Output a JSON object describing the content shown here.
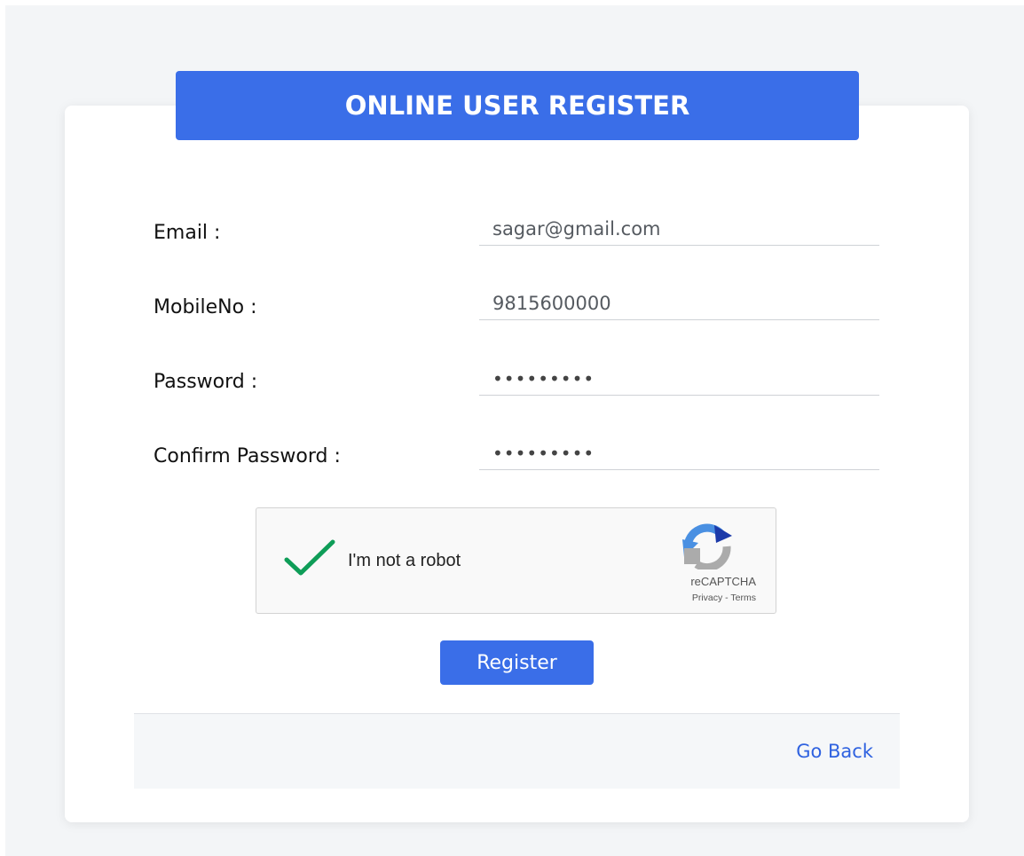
{
  "header": {
    "title": "ONLINE USER REGISTER"
  },
  "form": {
    "email_label": "Email :",
    "email_value": "sagar@gmail.com",
    "mobile_label": "MobileNo :",
    "mobile_value": "9815600000",
    "password_label": "Password :",
    "password_value": "•••••••••",
    "confirm_label": "Confirm Password :",
    "confirm_value": "•••••••••"
  },
  "recaptcha": {
    "checked": true,
    "label": "I'm not a robot",
    "brand": "reCAPTCHA",
    "privacy": "Privacy",
    "separator": " - ",
    "terms": "Terms",
    "check_color": "#0f9d58",
    "icon": "recaptcha-logo-icon"
  },
  "actions": {
    "register_label": "Register",
    "go_back_label": "Go Back"
  },
  "colors": {
    "primary": "#3a6ee8",
    "link": "#2f62e0",
    "page_bg": "#f3f5f7"
  }
}
